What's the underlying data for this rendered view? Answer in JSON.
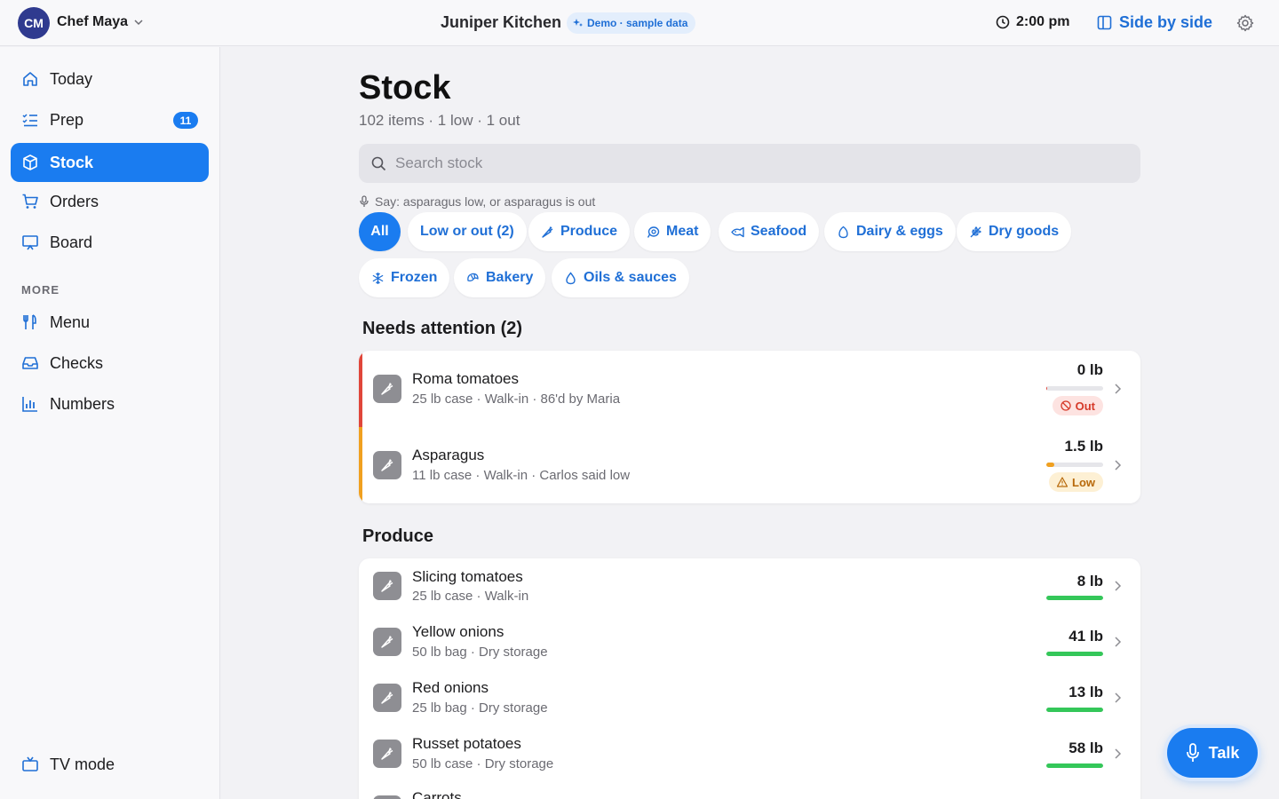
{
  "topbar": {
    "avatar_initials": "CM",
    "user_name": "Chef Maya",
    "app_title": "Juniper Kitchen",
    "demo_badge": "Demo · sample data",
    "time": "2:00 pm",
    "side_by_side": "Side by side"
  },
  "sidebar": {
    "items": [
      {
        "label": "Today",
        "icon": "home-icon"
      },
      {
        "label": "Prep",
        "icon": "checklist-icon",
        "badge": "11"
      },
      {
        "label": "Stock",
        "icon": "box-icon",
        "active": true
      },
      {
        "label": "Orders",
        "icon": "cart-icon"
      },
      {
        "label": "Board",
        "icon": "monitor-icon"
      }
    ],
    "more_label": "MORE",
    "more_items": [
      {
        "label": "Menu",
        "icon": "utensils-icon"
      },
      {
        "label": "Checks",
        "icon": "inbox-icon"
      },
      {
        "label": "Numbers",
        "icon": "chart-icon"
      }
    ],
    "tv_mode": "TV mode"
  },
  "main": {
    "title": "Stock",
    "subtitle": "102 items · 1 low · 1 out",
    "search_placeholder": "Search stock",
    "voice_hint": "Say: asparagus low, or asparagus is out",
    "filters": [
      "All",
      "Low or out (2)",
      "Produce",
      "Meat",
      "Seafood",
      "Dairy & eggs",
      "Dry goods",
      "Frozen",
      "Bakery",
      "Oils & sauces"
    ],
    "attention_title": "Needs attention (2)",
    "attention_items": [
      {
        "name": "Roma tomatoes",
        "meta": "25 lb case · Walk-in · 86'd by Maria",
        "qty": "0 lb",
        "status": "Out",
        "level": 0.02,
        "color": "#e0463a"
      },
      {
        "name": "Asparagus",
        "meta": "11 lb case · Walk-in · Carlos said low",
        "qty": "1.5 lb",
        "status": "Low",
        "level": 0.14,
        "color": "#f0a020"
      }
    ],
    "produce_title": "Produce",
    "produce_items": [
      {
        "name": "Slicing tomatoes",
        "meta": "25 lb case · Walk-in",
        "qty": "8 lb",
        "level": 1.0
      },
      {
        "name": "Yellow onions",
        "meta": "50 lb bag · Dry storage",
        "qty": "41 lb",
        "level": 1.0
      },
      {
        "name": "Red onions",
        "meta": "25 lb bag · Dry storage",
        "qty": "13 lb",
        "level": 1.0
      },
      {
        "name": "Russet potatoes",
        "meta": "50 lb case · Dry storage",
        "qty": "58 lb",
        "level": 1.0
      },
      {
        "name": "Carrots",
        "meta": "",
        "qty": "",
        "level": 1.0
      }
    ],
    "ok_color": "#34c759"
  },
  "talk_button": "Talk"
}
